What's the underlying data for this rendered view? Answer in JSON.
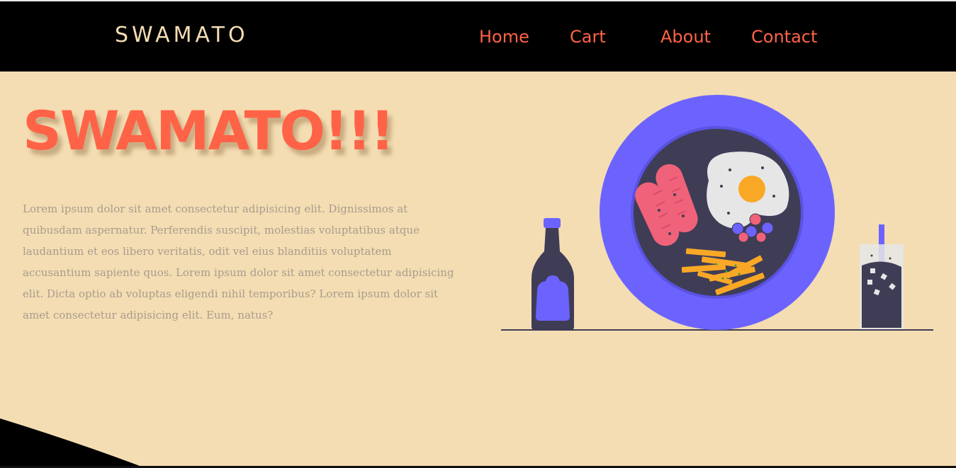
{
  "navbar": {
    "logo": "SWAMATO",
    "links": [
      "Home",
      "Cart",
      "About",
      "Contact"
    ]
  },
  "hero": {
    "title": "SWAMATO!!!",
    "text": "Lorem ipsum dolor sit amet consectetur adipisicing elit. Dignissimos at quibusdam aspernatur. Perferendis suscipit, molestias voluptatibus atque laudantium et eos libero veritatis, odit vel eius blanditiis voluptatem accusantium sapiente quos. Lorem ipsum dolor sit amet consectetur adipisicing elit. Dicta optio ab voluptas eligendi nihil temporibus? Lorem ipsum dolor sit amet consectetur adipisicing elit. Eum, natus?"
  },
  "colors": {
    "background": "#f4ddb2",
    "navbar": "#000000",
    "accent": "#ff6347",
    "plate": "#6c63ff",
    "dark": "#3f3d56"
  },
  "icons": [
    "ketchup-bottle-icon",
    "breakfast-plate-icon",
    "soda-glass-icon"
  ]
}
